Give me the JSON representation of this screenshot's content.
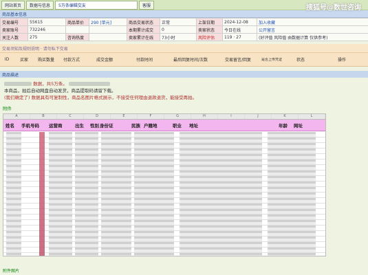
{
  "topbar": {
    "tabs": [
      "网站首页",
      "数据与信息",
      "5万条编辑交友",
      "客服"
    ],
    "watermark": "搜狐号@数世咨询"
  },
  "basic_info": {
    "header": "商品基本信息",
    "rows": [
      [
        {
          "label": "交易编号",
          "value": "55615"
        },
        {
          "label": "商品单价",
          "value": "290 [单元]"
        },
        {
          "label": "商品交易状态",
          "value": "正常"
        },
        {
          "label": "上架日期",
          "value": "2024-12-08"
        },
        {
          "value": "加入收藏"
        }
      ],
      [
        {
          "label": "卖家账号",
          "value": "732246"
        },
        {
          "label": "本期累计成交",
          "value": "0"
        },
        {
          "label": "卖家状态",
          "value": "今日在线"
        },
        {
          "value": "公开留言"
        }
      ],
      [
        {
          "label": "关注人数",
          "value": "275"
        },
        {
          "value": "咨询热度"
        },
        {
          "label": "卖家累计在线",
          "value": "73小时"
        },
        {
          "label": "风险评估",
          "value": "119 · 27"
        },
        {
          "value": "(好评值 风险值 由数据计算 仅供参考)"
        }
      ]
    ]
  },
  "notice_bar": "交易须知及规则说明 · 请勿私下交易",
  "order_columns": [
    "ID",
    "买家",
    "购买数量",
    "付款方式",
    "成交金额",
    "付款时间",
    "最后回复时间/次数",
    "交易留言/回复",
    "是否上传凭证",
    "状态",
    "操作"
  ],
  "description": {
    "header": "商品描述",
    "lines": [
      "数据，共5万条。",
      "本商品，拍后自动网盘自动发货，商品提取码请留下载。",
      "(我们确定了) 数据具有可复制性，商品名图片格式展示，不接受任何理由退款退货，能接受再拍。"
    ]
  },
  "attachment": {
    "label": "附件",
    "sheet_headers": [
      "姓名",
      "手机号码",
      "运营商",
      "出生",
      "性别",
      "身份证",
      "民族",
      "户籍地",
      "职业",
      "地址",
      "年龄",
      "网址"
    ],
    "bottom_note": "附件图片"
  }
}
